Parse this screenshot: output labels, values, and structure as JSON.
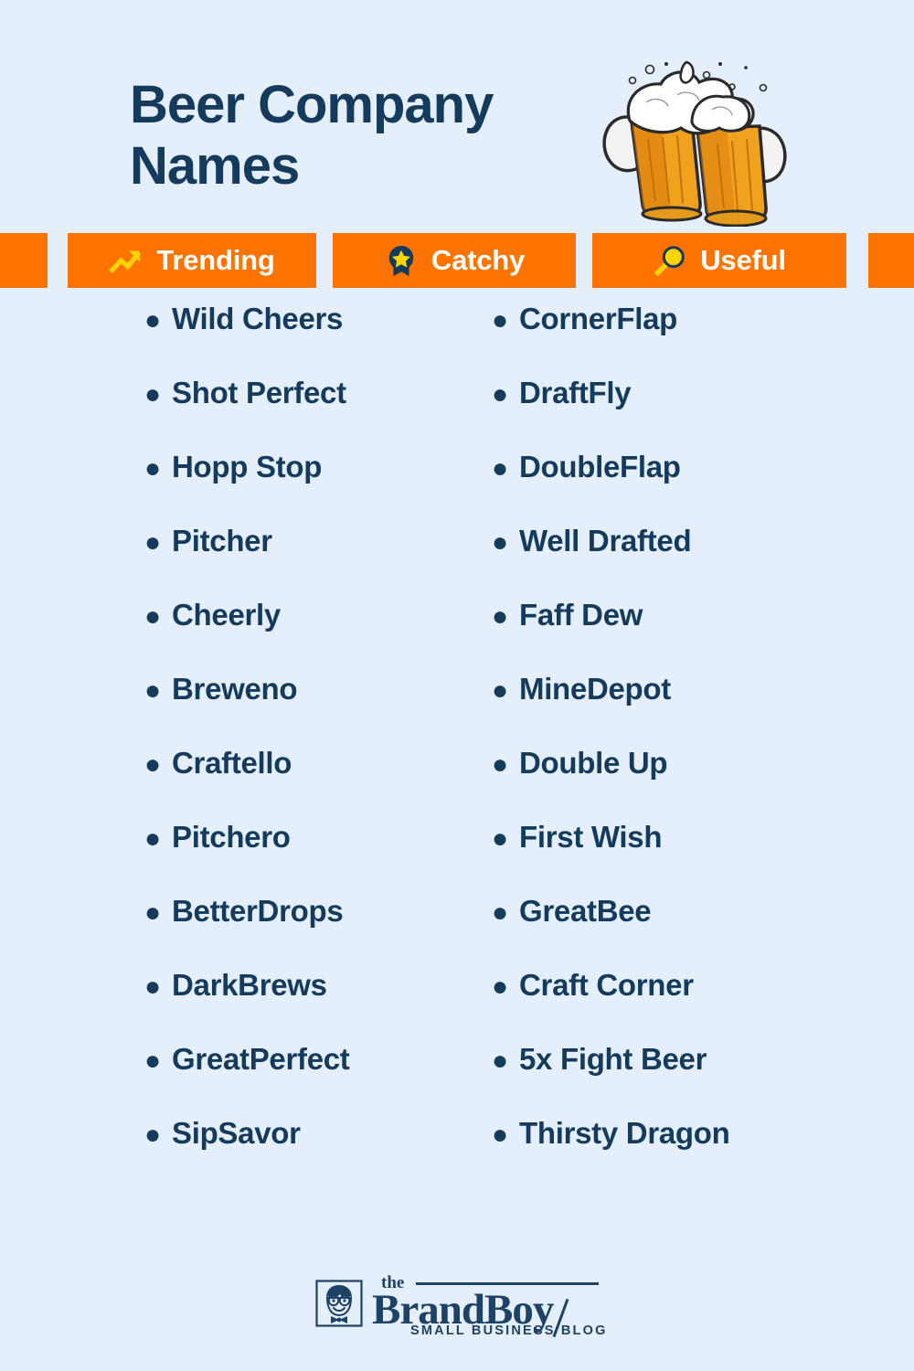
{
  "page": {
    "background_color": "#e4effb",
    "accent_color": "#ff7300",
    "text_color": "#143a5c",
    "icon_yellow": "#ffd400"
  },
  "header": {
    "title": "Beer Company Names",
    "title_line1": "Beer Company",
    "title_line2": "Names",
    "illustration": "two-clinking-beer-mugs"
  },
  "tabs": [
    {
      "label": "Trending",
      "icon": "trending-up-icon"
    },
    {
      "label": "Catchy",
      "icon": "award-badge-star-icon"
    },
    {
      "label": "Useful",
      "icon": "magnifying-glass-icon"
    }
  ],
  "lists": {
    "left_column": [
      "Wild Cheers",
      "Shot Perfect",
      "Hopp Stop",
      "Pitcher",
      "Cheerly",
      "Breweno",
      "Craftello",
      "Pitchero",
      "BetterDrops",
      "DarkBrews",
      "GreatPerfect",
      "SipSavor"
    ],
    "right_column": [
      "CornerFlap",
      "DraftFly",
      "DoubleFlap",
      "Well Drafted",
      "Faff Dew",
      "MineDepot",
      "Double Up",
      "First Wish",
      "GreatBee",
      "Craft Corner",
      "5x Fight Beer",
      "Thirsty Dragon"
    ]
  },
  "footer": {
    "logo_the": "the",
    "logo_name": "BrandBoy",
    "logo_tagline": "SMALL BUSINESS BLOG",
    "logo_mark": "boy-face-with-glasses-icon"
  }
}
